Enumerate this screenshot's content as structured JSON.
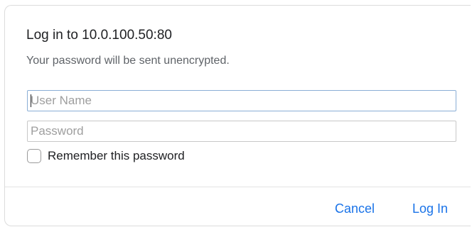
{
  "dialog": {
    "title": "Log in to 10.0.100.50:80",
    "subtitle": "Your password will be sent unencrypted.",
    "username_placeholder": "User Name",
    "password_placeholder": "Password",
    "remember_label": "Remember this password",
    "remember_checked": false,
    "cancel_label": "Cancel",
    "login_label": "Log In"
  },
  "colors": {
    "accent": "#1a73e8",
    "focus_border": "#8aaed6"
  }
}
